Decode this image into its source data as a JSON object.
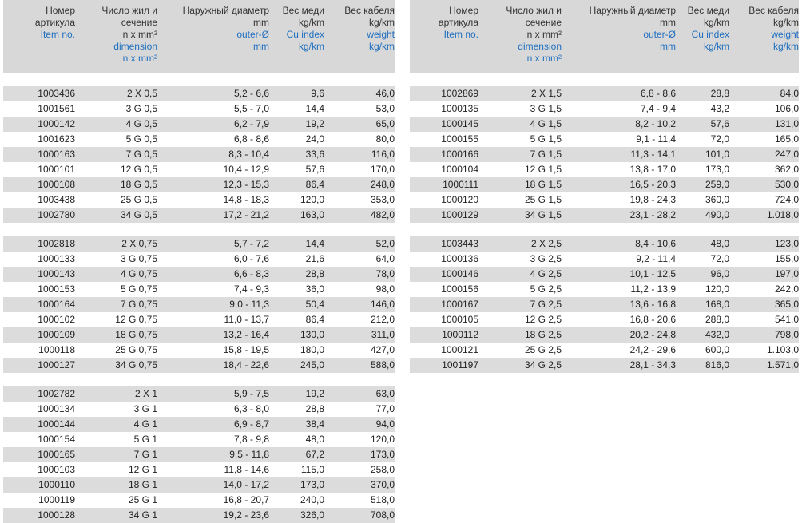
{
  "headers": [
    {
      "ru": [
        "Номер",
        "артикула"
      ],
      "en": [
        "Item no."
      ]
    },
    {
      "ru": [
        "Число жил и",
        "сечение",
        "n x mm²"
      ],
      "en": [
        "dimension",
        "n x mm²"
      ]
    },
    {
      "ru": [
        "Наружный диаметр",
        "mm"
      ],
      "en": [
        "outer-Ø",
        "mm"
      ]
    },
    {
      "ru": [
        "Вес меди",
        "kg/km"
      ],
      "en": [
        "Cu index",
        "kg/km"
      ]
    },
    {
      "ru": [
        "Вес кабеля",
        "kg/km"
      ],
      "en": [
        "weight",
        "kg/km"
      ]
    }
  ],
  "left_groups": [
    [
      [
        "1003436",
        "2 X 0,5",
        "5,2 - 6,6",
        "9,6",
        "46,0"
      ],
      [
        "1001561",
        "3 G 0,5",
        "5,5 - 7,0",
        "14,4",
        "53,0"
      ],
      [
        "1000142",
        "4 G 0,5",
        "6,2 - 7,9",
        "19,2",
        "65,0"
      ],
      [
        "1001623",
        "5 G 0,5",
        "6,8 - 8,6",
        "24,0",
        "80,0"
      ],
      [
        "1000163",
        "7 G 0,5",
        "8,3 - 10,4",
        "33,6",
        "116,0"
      ],
      [
        "1000101",
        "12 G 0,5",
        "10,4 - 12,9",
        "57,6",
        "170,0"
      ],
      [
        "1000108",
        "18 G 0,5",
        "12,3 - 15,3",
        "86,4",
        "248,0"
      ],
      [
        "1003438",
        "25 G 0,5",
        "14,8 - 18,3",
        "120,0",
        "353,0"
      ],
      [
        "1002780",
        "34 G 0,5",
        "17,2 - 21,2",
        "163,0",
        "482,0"
      ]
    ],
    [
      [
        "1002818",
        "2 X 0,75",
        "5,7 - 7,2",
        "14,4",
        "52,0"
      ],
      [
        "1000133",
        "3 G 0,75",
        "6,0 - 7,6",
        "21,6",
        "64,0"
      ],
      [
        "1000143",
        "4 G 0,75",
        "6,6 - 8,3",
        "28,8",
        "78,0"
      ],
      [
        "1000153",
        "5 G 0,75",
        "7,4 - 9,3",
        "36,0",
        "98,0"
      ],
      [
        "1000164",
        "7 G 0,75",
        "9,0 - 11,3",
        "50,4",
        "146,0"
      ],
      [
        "1000102",
        "12 G 0,75",
        "11,0 - 13,7",
        "86,4",
        "212,0"
      ],
      [
        "1000109",
        "18 G 0,75",
        "13,2 - 16,4",
        "130,0",
        "311,0"
      ],
      [
        "1000118",
        "25 G 0,75",
        "15,8 - 19,5",
        "180,0",
        "427,0"
      ],
      [
        "1000127",
        "34 G 0,75",
        "18,4 - 22,6",
        "245,0",
        "588,0"
      ]
    ],
    [
      [
        "1002782",
        "2 X 1",
        "5,9 - 7,5",
        "19,2",
        "63,0"
      ],
      [
        "1000134",
        "3 G 1",
        "6,3 - 8,0",
        "28,8",
        "77,0"
      ],
      [
        "1000144",
        "4 G 1",
        "6,9 - 8,7",
        "38,4",
        "94,0"
      ],
      [
        "1000154",
        "5 G 1",
        "7,8 - 9,8",
        "48,0",
        "120,0"
      ],
      [
        "1000165",
        "7 G 1",
        "9,5 - 11,8",
        "67,2",
        "173,0"
      ],
      [
        "1000103",
        "12 G 1",
        "11,8 - 14,6",
        "115,0",
        "258,0"
      ],
      [
        "1000110",
        "18 G 1",
        "14,0 - 17,2",
        "173,0",
        "370,0"
      ],
      [
        "1000119",
        "25 G 1",
        "16,8 - 20,7",
        "240,0",
        "518,0"
      ],
      [
        "1000128",
        "34 G 1",
        "19,2 - 23,6",
        "326,0",
        "708,0"
      ]
    ]
  ],
  "right_groups": [
    [
      [
        "1002869",
        "2 X 1,5",
        "6,8 - 8,6",
        "28,8",
        "84,0"
      ],
      [
        "1000135",
        "3 G 1,5",
        "7,4 - 9,4",
        "43,2",
        "106,0"
      ],
      [
        "1000145",
        "4 G 1,5",
        "8,2 - 10,2",
        "57,6",
        "131,0"
      ],
      [
        "1000155",
        "5 G 1,5",
        "9,1 - 11,4",
        "72,0",
        "165,0"
      ],
      [
        "1000166",
        "7 G 1,5",
        "11,3 - 14,1",
        "101,0",
        "247,0"
      ],
      [
        "1000104",
        "12 G 1,5",
        "13,8 - 17,0",
        "173,0",
        "362,0"
      ],
      [
        "1000111",
        "18 G 1,5",
        "16,5 - 20,3",
        "259,0",
        "530,0"
      ],
      [
        "1000120",
        "25 G 1,5",
        "19,8 - 24,3",
        "360,0",
        "724,0"
      ],
      [
        "1000129",
        "34 G 1,5",
        "23,1 - 28,2",
        "490,0",
        "1.018,0"
      ]
    ],
    [
      [
        "1003443",
        "2 X 2,5",
        "8,4 - 10,6",
        "48,0",
        "123,0"
      ],
      [
        "1000136",
        "3 G 2,5",
        "9,2 - 11,4",
        "72,0",
        "155,0"
      ],
      [
        "1000146",
        "4 G 2,5",
        "10,1 - 12,5",
        "96,0",
        "197,0"
      ],
      [
        "1000156",
        "5 G 2,5",
        "11,2 - 13,9",
        "120,0",
        "242,0"
      ],
      [
        "1000167",
        "7 G 2,5",
        "13,6 - 16,8",
        "168,0",
        "365,0"
      ],
      [
        "1000105",
        "12 G 2,5",
        "16,8 - 20,6",
        "288,0",
        "541,0"
      ],
      [
        "1000112",
        "18 G 2,5",
        "20,2 - 24,8",
        "432,0",
        "798,0"
      ],
      [
        "1000121",
        "25 G 2,5",
        "24,2 - 29,6",
        "600,0",
        "1.103,0"
      ],
      [
        "1001197",
        "34 G 2,5",
        "28,1 - 34,3",
        "816,0",
        "1.571,0"
      ]
    ]
  ],
  "colors": {
    "header_bg": "#d8d8d8",
    "row_shade": "#dcdcdc",
    "english_text": "#1f6fbf"
  }
}
